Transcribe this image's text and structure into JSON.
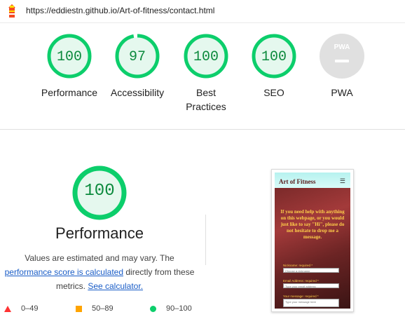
{
  "address_bar": {
    "url": "https://eddiestn.github.io/Art-of-fitness/contact.html",
    "logo_icon": "lighthouse-icon"
  },
  "colors": {
    "pass": "#0cce6b",
    "pass_text": "#0c8a3d",
    "average": "#ffa400",
    "fail": "#ff3333",
    "link": "#1a5dc7"
  },
  "summary": [
    {
      "score": "100",
      "label": "Performance",
      "value": 100
    },
    {
      "score": "97",
      "label": "Accessibility",
      "value": 97
    },
    {
      "score": "100",
      "label": "Best Practices",
      "value": 100
    },
    {
      "score": "100",
      "label": "SEO",
      "value": 100
    },
    {
      "score": "PWA",
      "label": "PWA"
    }
  ],
  "detail": {
    "score": "100",
    "title": "Performance",
    "desc_line1": "Values are estimated and may vary. The",
    "link_score": "performance score is calculated",
    "desc_mid": "directly from these",
    "desc_metrics": "metrics.",
    "link_calc": "See calculator."
  },
  "legend": [
    {
      "range": "0–49",
      "icon": "red-triangle-icon"
    },
    {
      "range": "50–89",
      "icon": "orange-square-icon"
    },
    {
      "range": "90–100",
      "icon": "green-circle-icon"
    }
  ],
  "thumbnail": {
    "brand": "Art of Fitness",
    "menu_icon": "hamburger-icon",
    "message": "If you need help with anything on this webpage, or you would just like to say \"Hi\", please do not hesitate to drop me a message.",
    "nickname_label": "Nickname: required *",
    "nickname_placeholder": "Choose a nickname",
    "email_label": "Email Address: required *",
    "email_placeholder": "Type your email address",
    "message_label": "Your message: required *",
    "message_placeholder": "Type your message here"
  }
}
